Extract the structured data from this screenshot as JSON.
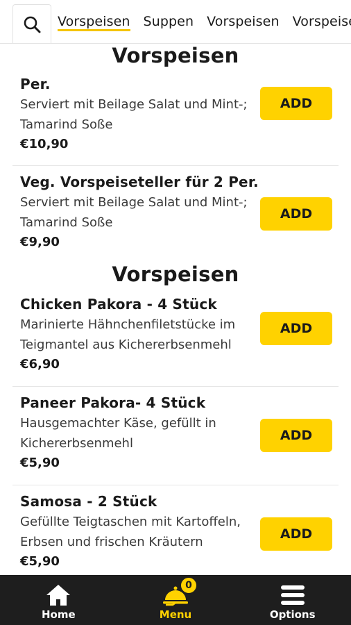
{
  "search": {
    "icon": "search-icon"
  },
  "tabs": [
    {
      "label": "Vorspeisen",
      "active": true
    },
    {
      "label": "Suppen",
      "active": false
    },
    {
      "label": "Vorspeisen",
      "active": false
    },
    {
      "label": "Vorspeisen",
      "active": false
    }
  ],
  "sections": [
    {
      "title": "Vorspeisen",
      "items": [
        {
          "name": "Per.",
          "description": "Serviert mit Beilage Salat und Mint-; Tamarind Soße",
          "price": "€10,90",
          "add_label": "ADD"
        },
        {
          "name": "Veg. Vorspeiseteller für 2 Per.",
          "description": "Serviert mit Beilage Salat und Mint-; Tamarind Soße",
          "price": "€9,90",
          "add_label": "ADD"
        }
      ]
    },
    {
      "title": "Vorspeisen",
      "items": [
        {
          "name": "Chicken Pakora - 4 Stück",
          "description": "Marinierte Hähnchenfiletstücke im Teigmantel aus Kichererbsenmehl",
          "price": "€6,90",
          "add_label": "ADD"
        },
        {
          "name": "Paneer Pakora- 4 Stück",
          "description": "Hausgemachter Käse, gefüllt in Kichererbsenmehl",
          "price": "€5,90",
          "add_label": "ADD"
        },
        {
          "name": "Samosa - 2 Stück",
          "description": "Gefüllte Teigtaschen mit Kartoffeln, Erbsen und frischen Kräutern",
          "price": "€5,90",
          "add_label": "ADD"
        }
      ]
    }
  ],
  "bottom_nav": [
    {
      "label": "Home",
      "icon": "home-icon",
      "active": false
    },
    {
      "label": "Menu",
      "icon": "menu-cloche-icon",
      "active": true,
      "badge": "0"
    },
    {
      "label": "Options",
      "icon": "hamburger-icon",
      "active": false
    }
  ],
  "colors": {
    "accent": "#ffd200",
    "nav_bg": "#1e1e1e"
  }
}
